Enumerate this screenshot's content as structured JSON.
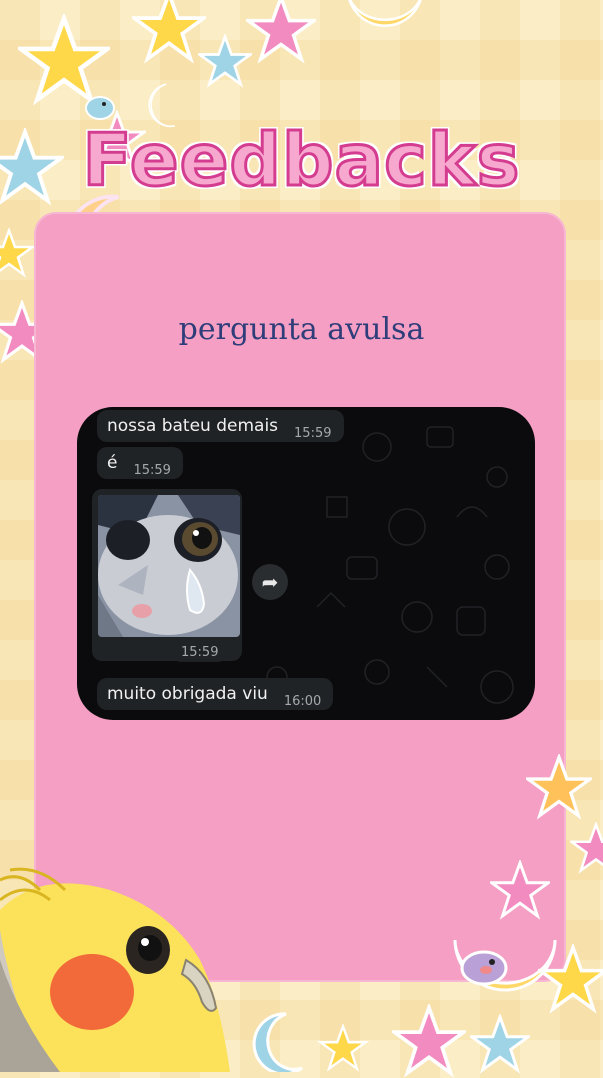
{
  "title": "Feedbacks",
  "card_heading": "pergunta avulsa",
  "chat": {
    "messages": [
      {
        "text": "nossa bateu demais",
        "time": "15:59"
      },
      {
        "text": "é",
        "time": "15:59"
      },
      {
        "text": "",
        "time": "15:59",
        "type": "image"
      },
      {
        "text": "muito obrigada viu",
        "time": "16:00"
      }
    ],
    "forward_icon": "forward-icon"
  },
  "colors": {
    "background": "#fbeec6",
    "card": "#f49fc3",
    "title_fill": "#f7a8cf",
    "title_stroke": "#d43d8f",
    "heading": "#2f3e7a",
    "chat_bg": "#0b0b0d",
    "bubble": "#202326"
  }
}
